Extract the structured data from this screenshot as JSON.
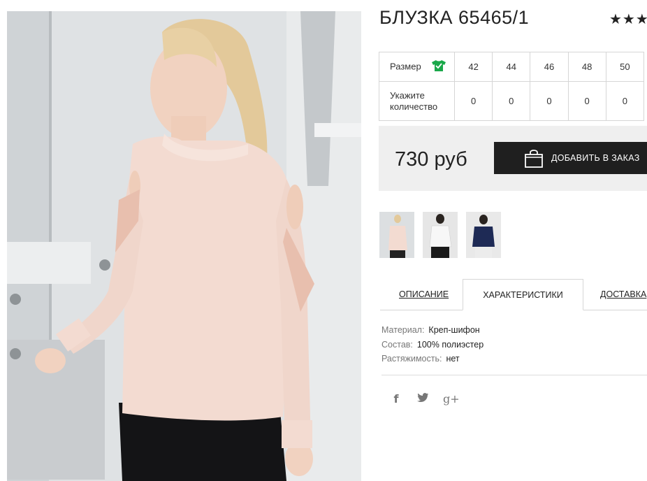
{
  "product": {
    "title": "БЛУЗКА 65465/1",
    "rating_stars": "★★★",
    "price": "730 руб",
    "add_to_cart_label": "ДОБАВИТЬ В ЗАКАЗ"
  },
  "size_table": {
    "size_label": "Размер",
    "quantity_label_line1": "Укажите",
    "quantity_label_line2": "количество",
    "sizes": [
      "42",
      "44",
      "46",
      "48",
      "50"
    ],
    "quantities": [
      "0",
      "0",
      "0",
      "0",
      "0"
    ]
  },
  "tabs": {
    "description": "ОПИСАНИЕ",
    "characteristics": "ХАРАКТЕРИСТИКИ",
    "delivery": "ДОСТАВКА"
  },
  "specs": [
    {
      "key": "Материал:",
      "value": "Креп-шифон"
    },
    {
      "key": "Состав:",
      "value": "100% полиэстер"
    },
    {
      "key": "Растяжимость:",
      "value": "нет"
    }
  ],
  "social": {
    "facebook": "f",
    "twitter": "🐦",
    "googleplus": "g+"
  },
  "colors": {
    "blouse": "#f2d9cf",
    "shirt_icon": "#1aa84a",
    "button_bg": "#1f1f1f",
    "price_bg": "#efefef"
  },
  "icons": [
    "shirt-icon",
    "shopping-bag-icon",
    "facebook-icon",
    "twitter-icon",
    "google-plus-icon"
  ]
}
